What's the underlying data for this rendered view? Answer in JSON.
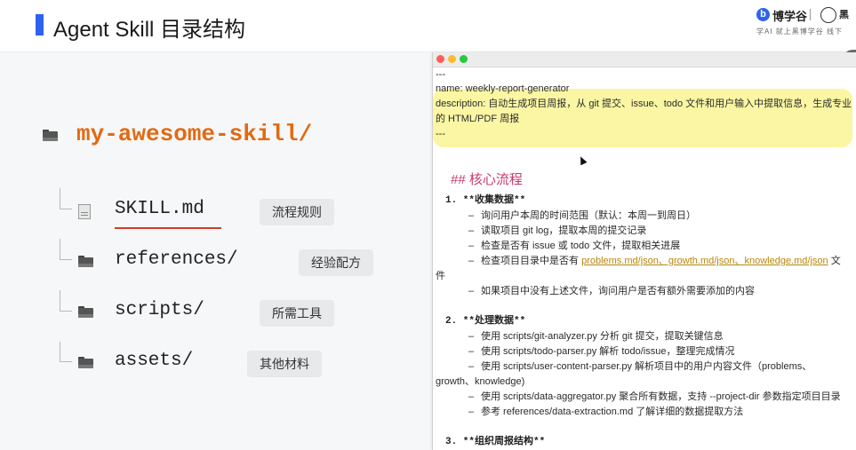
{
  "header": {
    "title": "Agent Skill 目录结构",
    "brand": {
      "logo_letter": "b",
      "name": "博学谷",
      "name2": "黑",
      "slogan": "学AI 就上黑博学谷 线下"
    },
    "accent_color": "#2f62ec"
  },
  "tree": {
    "root": "my-awesome-skill/",
    "items": [
      {
        "name": "SKILL.md",
        "tag": "流程规则",
        "icon": "document-icon"
      },
      {
        "name": "references/",
        "tag": "经验配方",
        "icon": "folder-icon"
      },
      {
        "name": "scripts/",
        "tag": "所需工具",
        "icon": "folder-icon"
      },
      {
        "name": "assets/",
        "tag": "其他材料",
        "icon": "folder-icon"
      }
    ]
  },
  "doc": {
    "dashes": "---",
    "frontmatter": {
      "name_line": "name: weekly-report-generator",
      "desc_line1": "description: 自动生成项目周报，从 git 提交、issue、todo 文件和用户输入中提取信息，生成专业",
      "desc_line2": "的 HTML/PDF 周报"
    },
    "heading": "## 核心流程",
    "sections": [
      {
        "title": "1. **收集数据**",
        "bullets": [
          "询问用户本周的时间范围（默认：本周一到周日）",
          "读取项目 git log，提取本周的提交记录",
          "检查是否有 issue 或 todo 文件，提取相关进展"
        ],
        "link_bullet": {
          "prefix": "检查项目目录中是否有 ",
          "link": "problems.md/json、growth.md/json、knowledge.md/json",
          "suffix": " 文",
          "continuation": "件"
        },
        "last_bullet": "如果项目中没有上述文件，询问用户是否有额外需要添加的内容"
      },
      {
        "title": "2. **处理数据**",
        "bullets": [
          "使用 scripts/git-analyzer.py 分析 git 提交，提取关键信息",
          "使用 scripts/todo-parser.py 解析 todo/issue，整理完成情况",
          "使用 scripts/user-content-parser.py 解析项目中的用户内容文件（problems、"
        ],
        "continuation": "growth、knowledge)",
        "more_bullets": [
          "使用 scripts/data-aggregator.py 聚合所有数据，支持 --project-dir 参数指定项目目录",
          "参考 references/data-extraction.md 了解详细的数据提取方法"
        ]
      },
      {
        "title": "3. **组织周报结构**"
      }
    ]
  }
}
